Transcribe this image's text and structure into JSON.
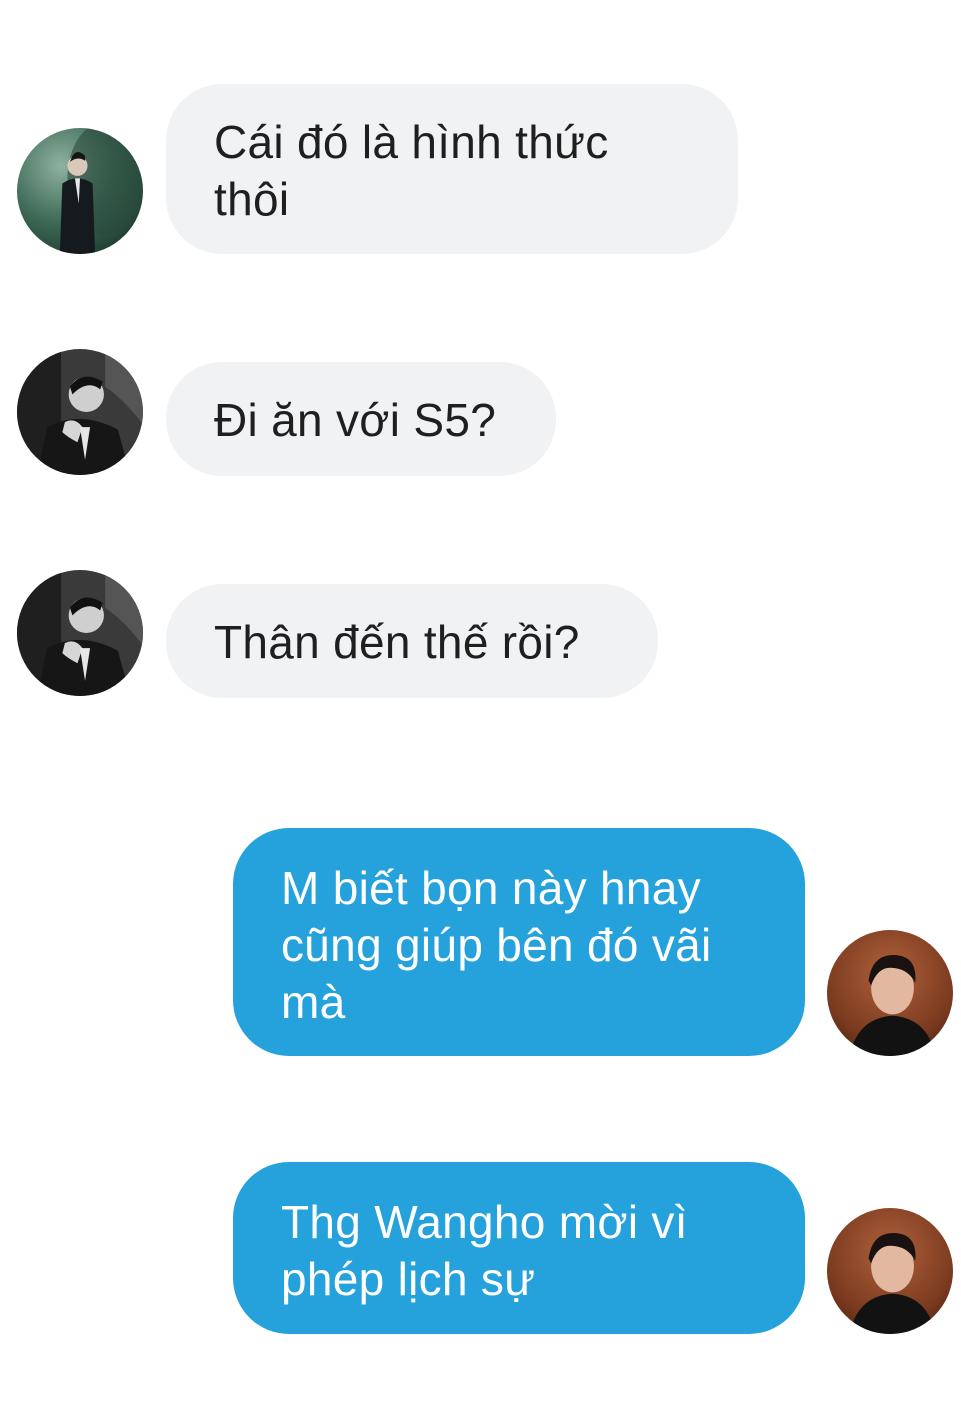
{
  "messages": [
    {
      "direction": "incoming",
      "avatar_icon": "avatar-green-suit-icon",
      "lines": [
        "Cái đó là hình thức",
        "thôi"
      ]
    },
    {
      "direction": "incoming",
      "avatar_icon": "avatar-bw-suit-icon",
      "lines": [
        "Đi ăn với S5?"
      ]
    },
    {
      "direction": "incoming",
      "avatar_icon": "avatar-bw-suit-icon",
      "lines": [
        "Thân đến thế rồi?"
      ]
    },
    {
      "direction": "outgoing",
      "avatar_icon": "avatar-brown-portrait-icon",
      "lines": [
        "M biết bọn này hnay",
        "cũng giúp bên đó vãi",
        "mà"
      ]
    },
    {
      "direction": "outgoing",
      "avatar_icon": "avatar-brown-portrait-icon",
      "lines": [
        "Thg Wangho mời vì",
        "phép lịch sự"
      ]
    }
  ],
  "colors": {
    "incoming_bubble": "#f1f2f4",
    "incoming_text": "#1f1f1f",
    "outgoing_bubble": "#25a2db",
    "outgoing_text": "#ffffff",
    "background": "#ffffff"
  }
}
